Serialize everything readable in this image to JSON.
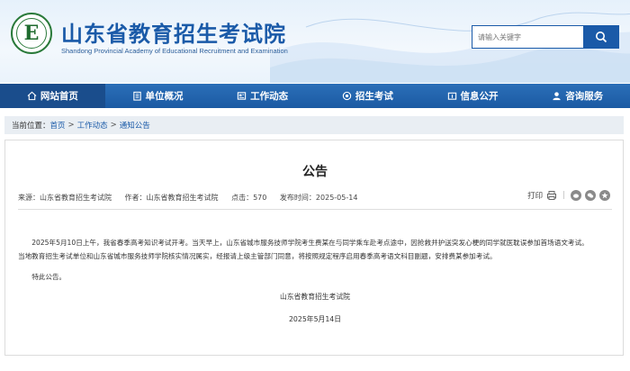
{
  "header": {
    "logo_letter": "E",
    "title": "山东省教育招生考试院",
    "subtitle": "Shandong Provincial Academy of Educational Recruitment and Examination"
  },
  "search": {
    "placeholder": "请输入关键字"
  },
  "nav": {
    "items": [
      {
        "label": "网站首页",
        "icon": "home-icon"
      },
      {
        "label": "单位概况",
        "icon": "building-icon"
      },
      {
        "label": "工作动态",
        "icon": "news-icon"
      },
      {
        "label": "招生考试",
        "icon": "exam-icon"
      },
      {
        "label": "信息公开",
        "icon": "info-icon"
      },
      {
        "label": "咨询服务",
        "icon": "user-service-icon"
      }
    ]
  },
  "breadcrumb": {
    "prefix": "当前位置：",
    "items": [
      "首页",
      "工作动态",
      "通知公告"
    ],
    "separator": ">"
  },
  "article": {
    "title": "公告",
    "source": "来源：山东省教育招生考试院",
    "author": "作者：山东省教育招生考试院",
    "clicks": "点击：570",
    "published": "发布时间：2025-05-14",
    "print_label": "打印",
    "paragraph1_line1": "2025年5月10日上午，我省春季高考知识考试开考。当天早上，山东省城市服务技师学院考生费某在与同学乘车赴考点途中，因抢救并护送突发心梗的同学就医耽误参加首场语文考试。",
    "paragraph1_line2": "当地教育招生考试单位和山东省城市服务技师学院核实情况属实，经报请上级主管部门同意，将按照规定程序启用春季高考语文科目副题，安排费某参加考试。",
    "paragraph2": "特此公告。",
    "signature": "山东省教育招生考试院",
    "date": "2025年5月14日"
  },
  "colors": {
    "brand_blue": "#1a5aa8",
    "nav_active": "#1a4d8c",
    "logo_green": "#2a7a3a"
  }
}
